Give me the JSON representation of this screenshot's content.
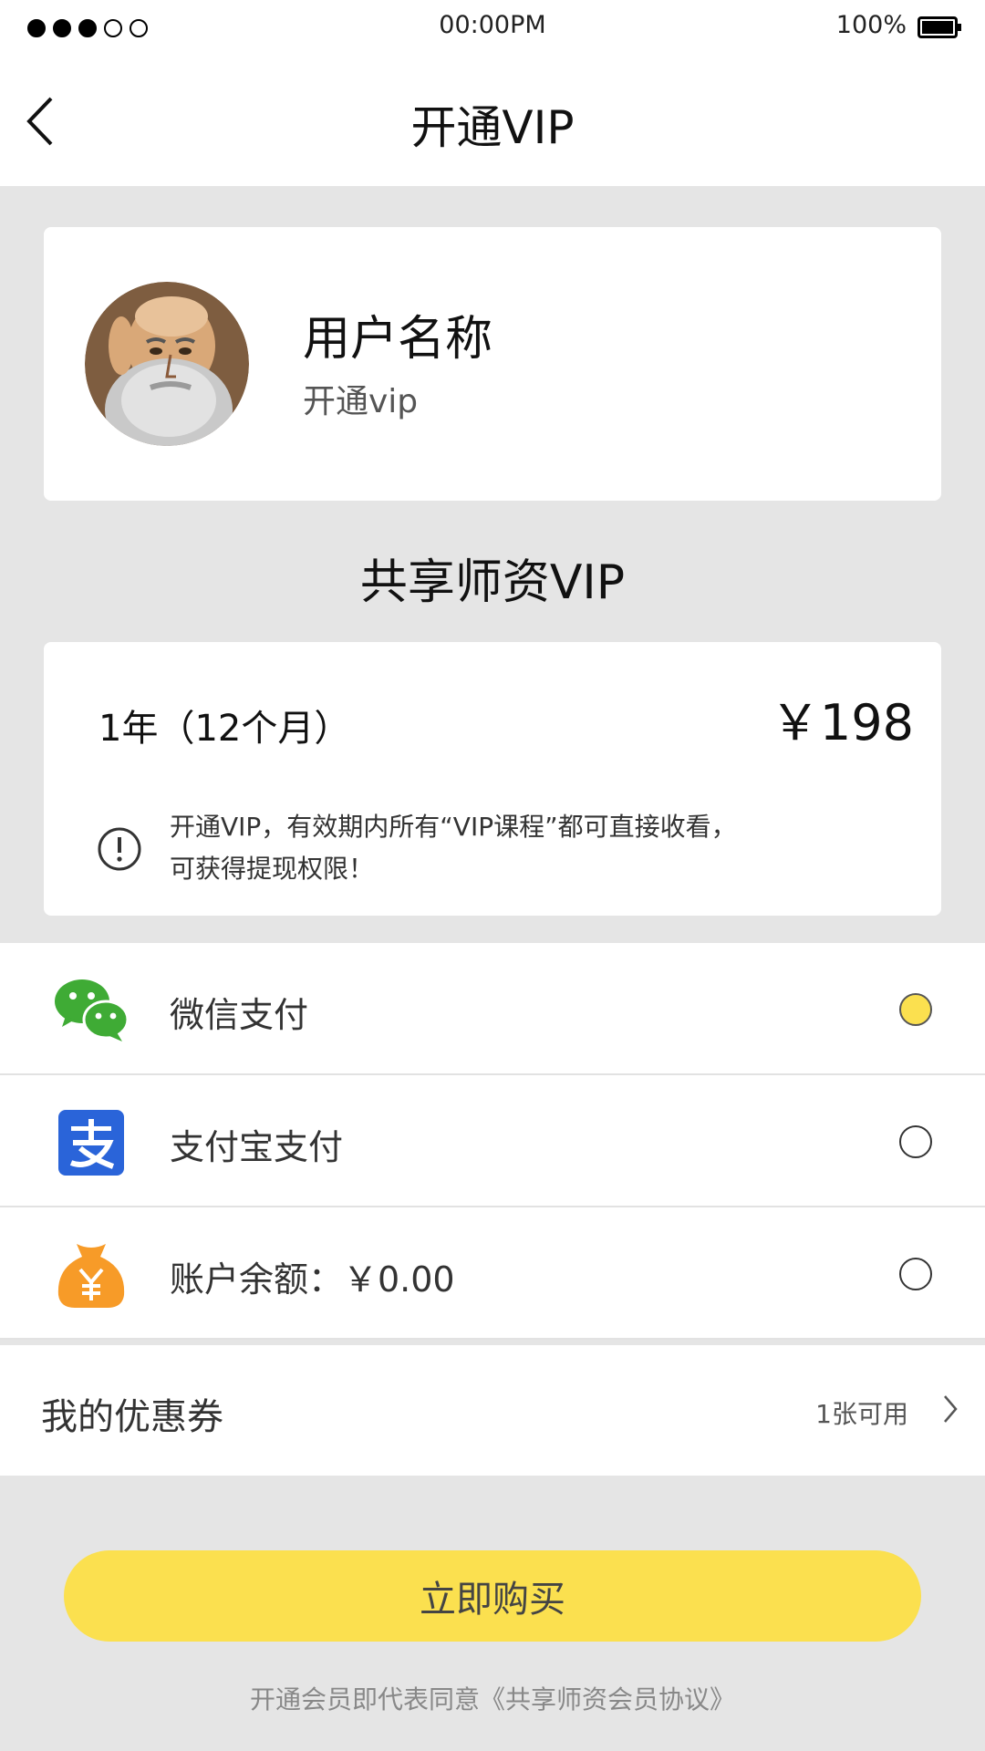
{
  "status_bar": {
    "time": "00:00PM",
    "battery": "100%"
  },
  "nav": {
    "title": "开通VIP"
  },
  "user": {
    "name": "用户名称",
    "subtitle": "开通vip"
  },
  "section_title": "共享师资VIP",
  "plan": {
    "name": "1年（12个月）",
    "price": "￥198",
    "note_line1": "开通VIP，有效期内所有“VIP课程”都可直接收看，",
    "note_line2": "可获得提现权限！"
  },
  "payment": {
    "options": [
      {
        "label": "微信支付",
        "icon": "wechat-icon",
        "selected": true
      },
      {
        "label": "支付宝支付",
        "icon": "alipay-icon",
        "selected": false
      },
      {
        "label": "账户余额：￥0.00",
        "icon": "money-bag-icon",
        "selected": false
      }
    ]
  },
  "coupon": {
    "label": "我的优惠券",
    "count": "1张可用"
  },
  "buy_button": "立即购买",
  "agreement": "开通会员即代表同意《共享师资会员协议》",
  "colors": {
    "accent": "#fbe04f",
    "wechat": "#3fab35",
    "alipay": "#2a64d9",
    "balance": "#f79b28",
    "background": "#e5e5e5"
  }
}
